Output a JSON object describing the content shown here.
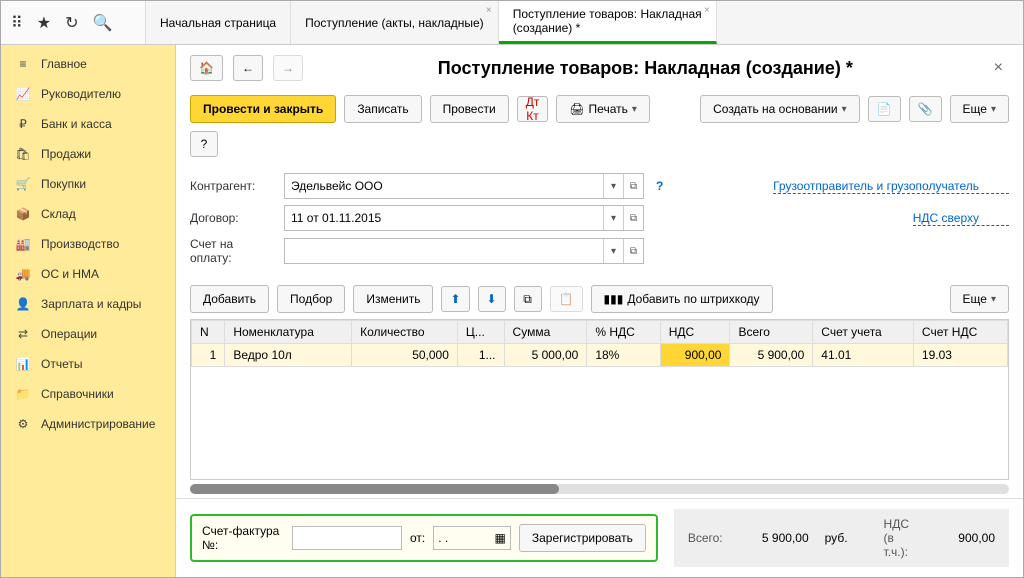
{
  "tabs": [
    {
      "label": "Начальная страница"
    },
    {
      "label": "Поступление (акты, накладные)",
      "closable": true
    },
    {
      "label1": "Поступление товаров: Накладная",
      "label2": "(создание) *",
      "closable": true,
      "active": true
    }
  ],
  "sidebar": {
    "items": [
      {
        "icon": "≡",
        "label": "Главное"
      },
      {
        "icon": "📈",
        "label": "Руководителю"
      },
      {
        "icon": "₽",
        "label": "Банк и касса"
      },
      {
        "icon": "🛍",
        "label": "Продажи"
      },
      {
        "icon": "🛒",
        "label": "Покупки"
      },
      {
        "icon": "📦",
        "label": "Склад"
      },
      {
        "icon": "🏭",
        "label": "Производство"
      },
      {
        "icon": "🚚",
        "label": "ОС и НМА"
      },
      {
        "icon": "👤",
        "label": "Зарплата и кадры"
      },
      {
        "icon": "⇄",
        "label": "Операции"
      },
      {
        "icon": "📊",
        "label": "Отчеты"
      },
      {
        "icon": "📁",
        "label": "Справочники"
      },
      {
        "icon": "⚙",
        "label": "Администрирование"
      }
    ]
  },
  "page": {
    "title": "Поступление товаров: Накладная (создание) *",
    "buttons": {
      "post_close": "Провести и закрыть",
      "save": "Записать",
      "post": "Провести",
      "print": "Печать",
      "create_based": "Создать на основании",
      "more": "Еще",
      "help": "?"
    },
    "form": {
      "contractor_label": "Контрагент:",
      "contractor_value": "Эдельвейс ООО",
      "contract_label": "Договор:",
      "contract_value": "11 от 01.11.2015",
      "account_label": "Счет на оплату:",
      "account_value": "",
      "shipper_link": "Грузоотправитель и грузополучатель",
      "vat_link": "НДС сверху"
    },
    "table_toolbar": {
      "add": "Добавить",
      "select": "Подбор",
      "edit": "Изменить",
      "barcode": "Добавить по штрихкоду",
      "more": "Еще"
    },
    "columns": [
      "N",
      "Номенклатура",
      "Количество",
      "Ц...",
      "Сумма",
      "% НДС",
      "НДС",
      "Всего",
      "Счет учета",
      "Счет НДС"
    ],
    "rows": [
      {
        "n": "1",
        "name": "Ведро 10л",
        "qty": "50,000",
        "price": "1...",
        "sum": "5 000,00",
        "vat_pct": "18%",
        "vat": "900,00",
        "total": "5 900,00",
        "acct": "41.01",
        "vat_acct": "19.03"
      }
    ],
    "invoice": {
      "label": "Счет-фактура №:",
      "from": "от:",
      "date_placeholder": ".  .",
      "register": "Зарегистрировать"
    },
    "totals": {
      "total_label": "Всего:",
      "total_value": "5 900,00",
      "currency": "руб.",
      "vat_label": "НДС (в т.ч.):",
      "vat_value": "900,00"
    }
  }
}
